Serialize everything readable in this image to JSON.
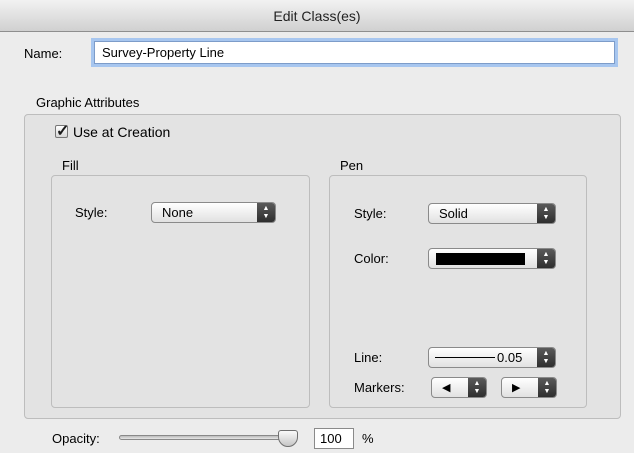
{
  "window": {
    "title": "Edit Class(es)"
  },
  "name": {
    "label": "Name:",
    "value": "Survey-Property Line"
  },
  "graphic_attributes": {
    "heading": "Graphic Attributes"
  },
  "use_at_creation": {
    "label": "Use at Creation",
    "checked": true
  },
  "fill": {
    "heading": "Fill",
    "style_label": "Style:",
    "style_value": "None"
  },
  "pen": {
    "heading": "Pen",
    "style_label": "Style:",
    "style_value": "Solid",
    "color_label": "Color:",
    "color_value": "#000000",
    "line_label": "Line:",
    "line_value": "0.05",
    "markers_label": "Markers:",
    "marker_start_glyph": "◀",
    "marker_end_glyph": "▶"
  },
  "opacity": {
    "label": "Opacity:",
    "value": "100",
    "unit": "%",
    "level": 1.0
  },
  "icons": {
    "popup_arrows": "up-down-arrows-icon",
    "checkmark": "checkmark-icon"
  }
}
